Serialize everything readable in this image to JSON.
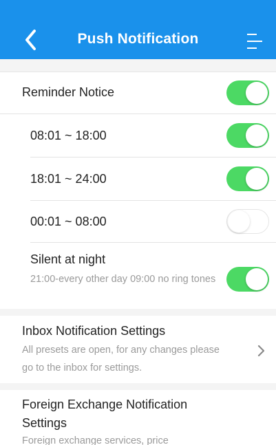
{
  "header": {
    "title": "Push Notification",
    "bg_color": "#1a91eb",
    "back_icon": "chevron-left-icon",
    "menu_icon": "hamburger-menu-icon"
  },
  "reminder": {
    "label": "Reminder Notice",
    "enabled": true
  },
  "time_slots": [
    {
      "label": "08:01 ~ 18:00",
      "enabled": true
    },
    {
      "label": "18:01 ~ 24:00",
      "enabled": true
    },
    {
      "label": "00:01 ~ 08:00",
      "enabled": false
    }
  ],
  "silent_night": {
    "label": "Silent at night",
    "description": "21:00-every other day 09:00 no ring tones",
    "enabled": true
  },
  "inbox": {
    "title": "Inbox Notification Settings",
    "description": "All presets are open, for any changes please go to the inbox for settings."
  },
  "forex": {
    "title": "Foreign Exchange Notification Settings",
    "description": "Foreign exchange services, price"
  },
  "colors": {
    "toggle_on": "#4cd964",
    "toggle_off_border": "#e5e5e5"
  }
}
